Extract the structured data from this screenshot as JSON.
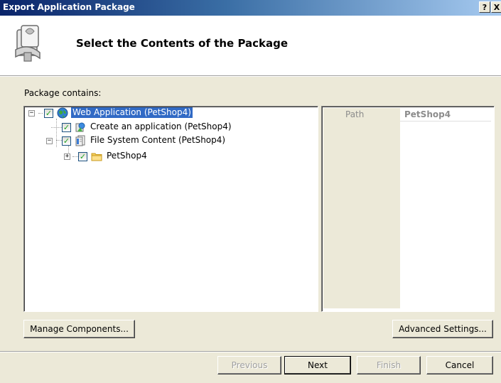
{
  "window": {
    "title": "Export Application Package",
    "help_glyph": "?",
    "close_glyph": "X"
  },
  "header": {
    "heading": "Select the Contents of the Package",
    "icon": "package-icon"
  },
  "package": {
    "label": "Package contains:"
  },
  "tree": {
    "nodes": [
      {
        "label": "Web Application (PetShop4)",
        "icon": "globe-icon",
        "checked": true,
        "expanded": true,
        "selected": true
      },
      {
        "label": "Create an application (PetShop4)",
        "icon": "application-icon",
        "checked": true
      },
      {
        "label": "File System Content (PetShop4)",
        "icon": "files-icon",
        "checked": true,
        "expanded": true
      },
      {
        "label": "PetShop4",
        "icon": "folder-icon",
        "checked": true,
        "expanded": false
      }
    ]
  },
  "properties": {
    "rows": [
      {
        "name": "Path",
        "value": "PetShop4"
      }
    ]
  },
  "buttons": {
    "manage_components": "Manage Components...",
    "advanced_settings": "Advanced Settings...",
    "previous": "Previous",
    "next": "Next",
    "finish": "Finish",
    "cancel": "Cancel"
  },
  "glyphs": {
    "check": "✓",
    "minus": "−",
    "plus": "+"
  }
}
